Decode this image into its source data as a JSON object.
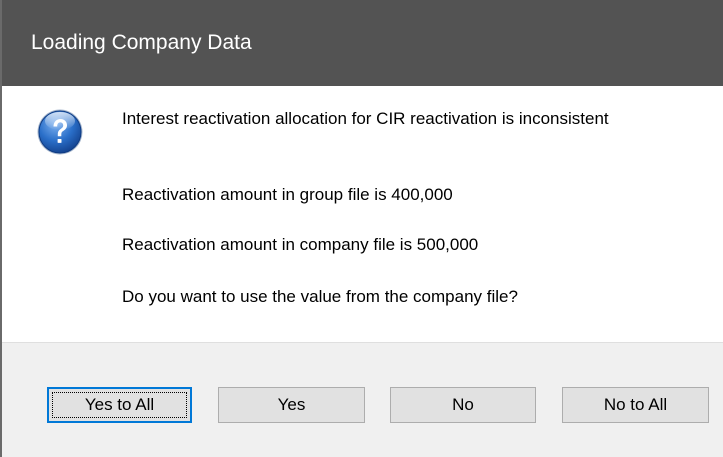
{
  "window": {
    "title": "Loading Company Data"
  },
  "message": {
    "icon": "question-icon",
    "line1": "Interest reactivation allocation for CIR reactivation is inconsistent",
    "line2": "Reactivation amount in group file is 400,000",
    "line3": "Reactivation amount in company file is 500,000",
    "line4": "Do you want to use the value from the company file?"
  },
  "buttons": {
    "yes_to_all": "Yes to All",
    "yes": "Yes",
    "no": "No",
    "no_to_all": "No to All"
  },
  "colors": {
    "titlebar": "#535353",
    "footer": "#f0f0f0",
    "button": "#e1e1e1",
    "focus_border": "#0078d7",
    "icon_blue": "#1d5fb5"
  }
}
